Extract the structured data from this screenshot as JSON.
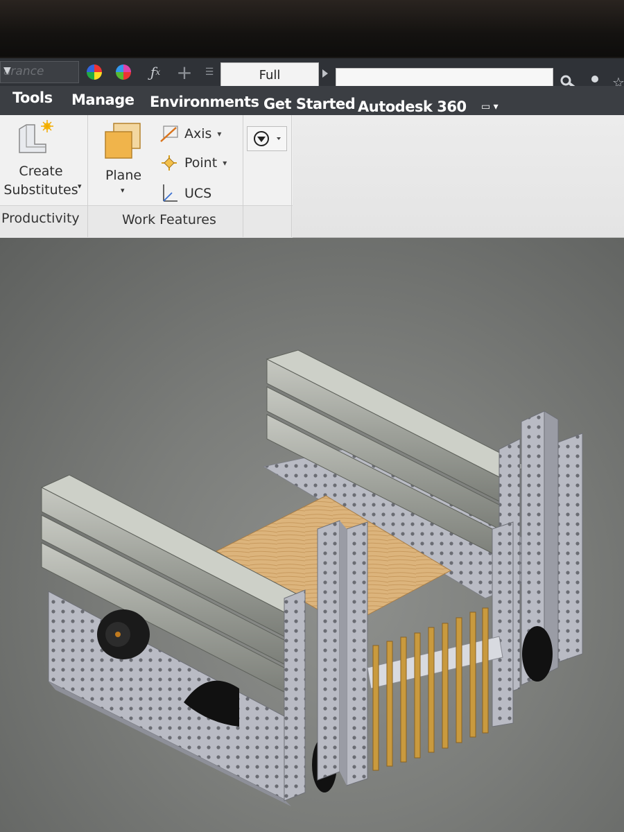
{
  "quick_access": {
    "appearance_combo": "arance",
    "view_mode": "Full"
  },
  "tabs": [
    "Tools",
    "Manage",
    "Environments",
    "Get Started",
    "Autodesk 360"
  ],
  "ribbon": {
    "productivity": {
      "create_substitutes_line1": "Create",
      "create_substitutes_line2": "Substitutes",
      "panel_label": "Productivity"
    },
    "work_features": {
      "plane_label": "Plane",
      "axis_label": "Axis",
      "point_label": "Point",
      "ucs_label": "UCS",
      "panel_label": "Work Features"
    }
  },
  "icons": {
    "qat": [
      "color-override-icon",
      "clear-color-icon",
      "fx-parameters-icon",
      "move-icon",
      "customize-icon"
    ],
    "search": [
      "search-icon",
      "sign-in-icon",
      "favorite-icon"
    ],
    "ribbon": [
      "create-substitutes-icon",
      "plane-icon",
      "axis-icon",
      "point-icon",
      "ucs-icon",
      "panel-dropdown-icon"
    ]
  },
  "colors": {
    "ribbon_bg": "#f1f1f1",
    "tab_bar": "#3b3e43",
    "viewport_bg": "#7b7d7a",
    "frame_metal": "#b4b6bf",
    "plywood": "#d9b27a",
    "brass_rods": "#c99a3e"
  }
}
